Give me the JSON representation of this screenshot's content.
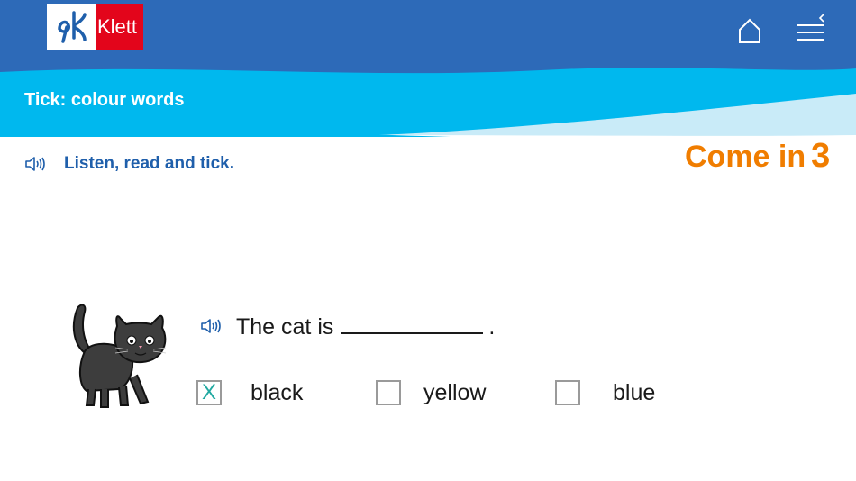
{
  "header": {
    "brand": "Klett",
    "title": "Tick: colour words",
    "home_icon": "home-icon",
    "menu_icon": "hamburger-menu-icon",
    "colors": {
      "dark_blue": "#2d6ab8",
      "light_blue": "#00b8ee",
      "pale_blue": "#c9ebf8"
    }
  },
  "instruction": {
    "text": "Listen, read and tick.",
    "icon": "speaker-icon"
  },
  "series": {
    "name": "Come in",
    "number": "3",
    "color": "#f07d00"
  },
  "question": {
    "before": "The cat is",
    "after": ".",
    "icon": "speaker-icon"
  },
  "options": [
    {
      "label": "black",
      "checked": true,
      "mark": "X"
    },
    {
      "label": "yellow",
      "checked": false,
      "mark": ""
    },
    {
      "label": "blue",
      "checked": false,
      "mark": ""
    }
  ]
}
